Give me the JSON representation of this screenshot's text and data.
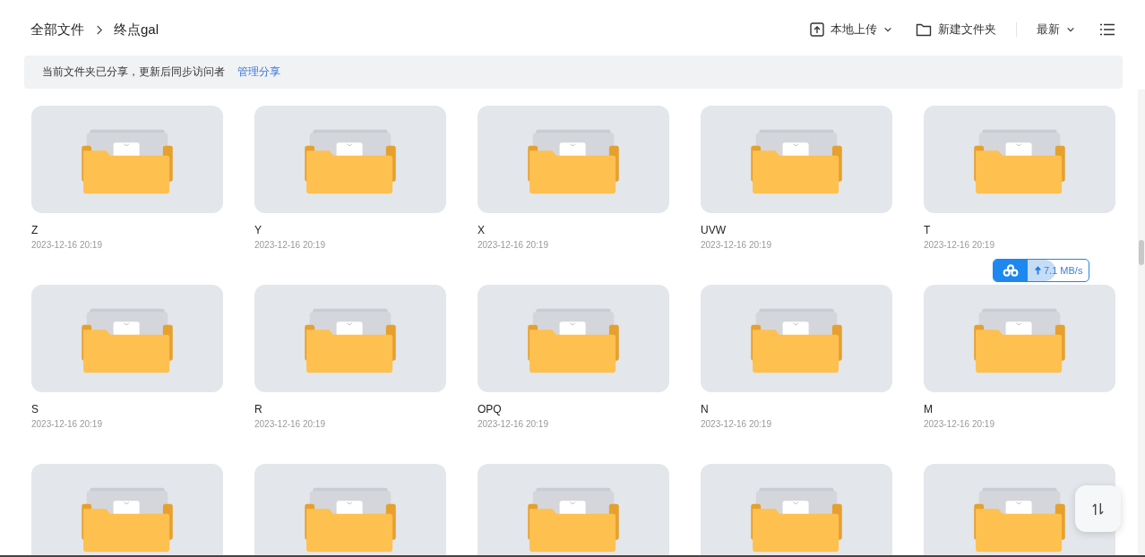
{
  "breadcrumb": [
    {
      "label": "全部文件"
    },
    {
      "label": "终点gal"
    }
  ],
  "toolbar": {
    "upload": "本地上传",
    "new_folder": "新建文件夹",
    "sort": "最新"
  },
  "share_notice": {
    "text": "当前文件夹已分享，更新后同步访问者",
    "link": "管理分享"
  },
  "folders": [
    {
      "kind": "full",
      "name": "Z",
      "date": "2023-12-16 20:19"
    },
    {
      "kind": "full",
      "name": "Y",
      "date": "2023-12-16 20:19"
    },
    {
      "kind": "full",
      "name": "X",
      "date": "2023-12-16 20:19"
    },
    {
      "kind": "full",
      "name": "UVW",
      "date": "2023-12-16 20:19"
    },
    {
      "kind": "full",
      "name": "T",
      "date": "2023-12-16 20:19"
    },
    {
      "kind": "full",
      "name": "S",
      "date": "2023-12-16 20:19"
    },
    {
      "kind": "full",
      "name": "R",
      "date": "2023-12-16 20:19"
    },
    {
      "kind": "full",
      "name": "OPQ",
      "date": "2023-12-16 20:19"
    },
    {
      "kind": "full",
      "name": "N",
      "date": "2023-12-16 20:19"
    },
    {
      "kind": "full",
      "name": "M",
      "date": "2023-12-16 20:19"
    },
    {
      "kind": "cut_off"
    },
    {
      "kind": "cut_off"
    },
    {
      "kind": "cut_off"
    },
    {
      "kind": "cut_off"
    },
    {
      "kind": "cut_off"
    }
  ],
  "upload_speed": {
    "text": "7.1 MB/s",
    "level": 0.45
  }
}
